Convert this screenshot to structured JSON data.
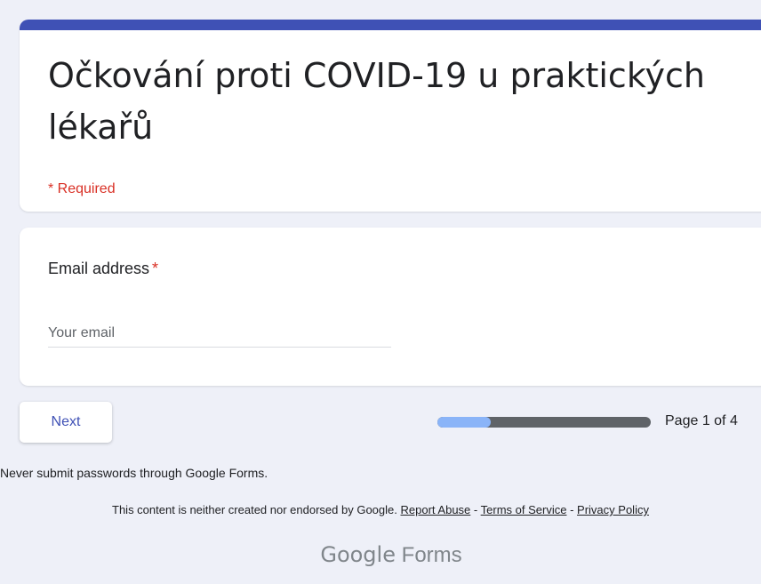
{
  "form": {
    "title": "Očkování proti COVID-19 u praktických lékařů",
    "required_note": "* Required",
    "accent_color": "#3f51b5"
  },
  "question": {
    "label": "Email address",
    "required_marker": "*",
    "input_value": "",
    "input_placeholder": "Your email"
  },
  "navigation": {
    "next_label": "Next",
    "progress_fraction": 0.25,
    "page_text": "Page 1 of 4"
  },
  "footer": {
    "password_warning": "Never submit passwords through Google Forms.",
    "disclaimer_text": "This content is neither created nor endorsed by Google.",
    "separator": "-",
    "links": {
      "report_abuse": "Report Abuse",
      "terms": "Terms of Service",
      "privacy": "Privacy Policy"
    },
    "brand_google": "Google",
    "brand_forms": "Forms"
  },
  "colors": {
    "background": "#eef0f8",
    "required": "#d93025",
    "progress_fill": "#8ab4f8",
    "progress_track": "#5f6368"
  }
}
